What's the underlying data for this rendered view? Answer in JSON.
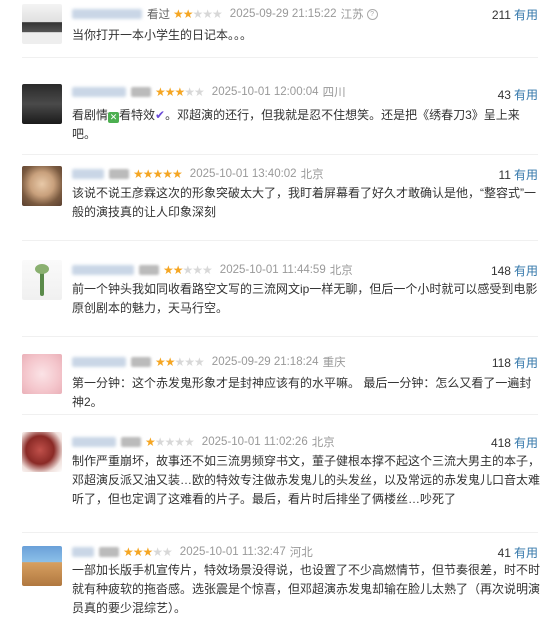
{
  "accent_link": "#3377aa",
  "star_color": "#f5a623",
  "reviews": [
    {
      "rating_label": "看过",
      "stars": 2,
      "date": "2025-09-29 21:15:22",
      "location": "江苏",
      "useful_count": "211",
      "useful_label": "有用",
      "text": "当你打开一本小学生的日记本。。。"
    },
    {
      "rating_label": "",
      "stars": 3,
      "date": "2025-10-01 12:00:04",
      "location": "四川",
      "useful_count": "43",
      "useful_label": "有用",
      "text_a": "看剧情",
      "text_b": "看特效",
      "text_c": "。邓超演的还行，但我就是忍不住想笑。还是把《绣春刀3》呈上来吧。"
    },
    {
      "rating_label": "",
      "stars": 5,
      "date": "2025-10-01 13:40:02",
      "location": "北京",
      "useful_count": "11",
      "useful_label": "有用",
      "text": "该说不说王彦霖这次的形象突破太大了，我盯着屏幕看了好久才敢确认是他，“整容式”一般的演技真的让人印象深刻"
    },
    {
      "rating_label": "",
      "stars": 2,
      "date": "2025-10-01 11:44:59",
      "location": "北京",
      "useful_count": "148",
      "useful_label": "有用",
      "text": "前一个钟头我如同收看路空文写的三流网文ip一样无聊，但后一个小时就可以感受到电影原创剧本的魅力，天马行空。"
    },
    {
      "rating_label": "",
      "stars": 2,
      "date": "2025-09-29 21:18:24",
      "location": "重庆",
      "useful_count": "118",
      "useful_label": "有用",
      "text": "第一分钟：这个赤发鬼形象才是封神应该有的水平嘛。 最后一分钟：怎么又看了一遍封神2。"
    },
    {
      "rating_label": "",
      "stars": 1,
      "date": "2025-10-01 11:02:26",
      "location": "北京",
      "useful_count": "418",
      "useful_label": "有用",
      "text": "制作严重崩坏，故事还不如三流男频穿书文，董子健根本撑不起这个三流大男主的本子，邓超演反派又油又装…欧的特效专注做赤发鬼儿的头发丝，以及常远的赤发鬼儿口音太难听了，但也定调了这难看的片子。最后，看片时后排坐了俩楼丝…吵死了"
    },
    {
      "rating_label": "",
      "stars": 3,
      "date": "2025-10-01 11:32:47",
      "location": "河北",
      "useful_count": "41",
      "useful_label": "有用",
      "text": "一部加长版手机宣传片，特效场景没得说，也设置了不少高燃情节，但节奏很差，时不时就有种疲软的拖沓感。选张震是个惊喜，但邓超演赤发鬼却输在脸儿太熟了（再次说明演员真的要少混综艺）。"
    }
  ]
}
